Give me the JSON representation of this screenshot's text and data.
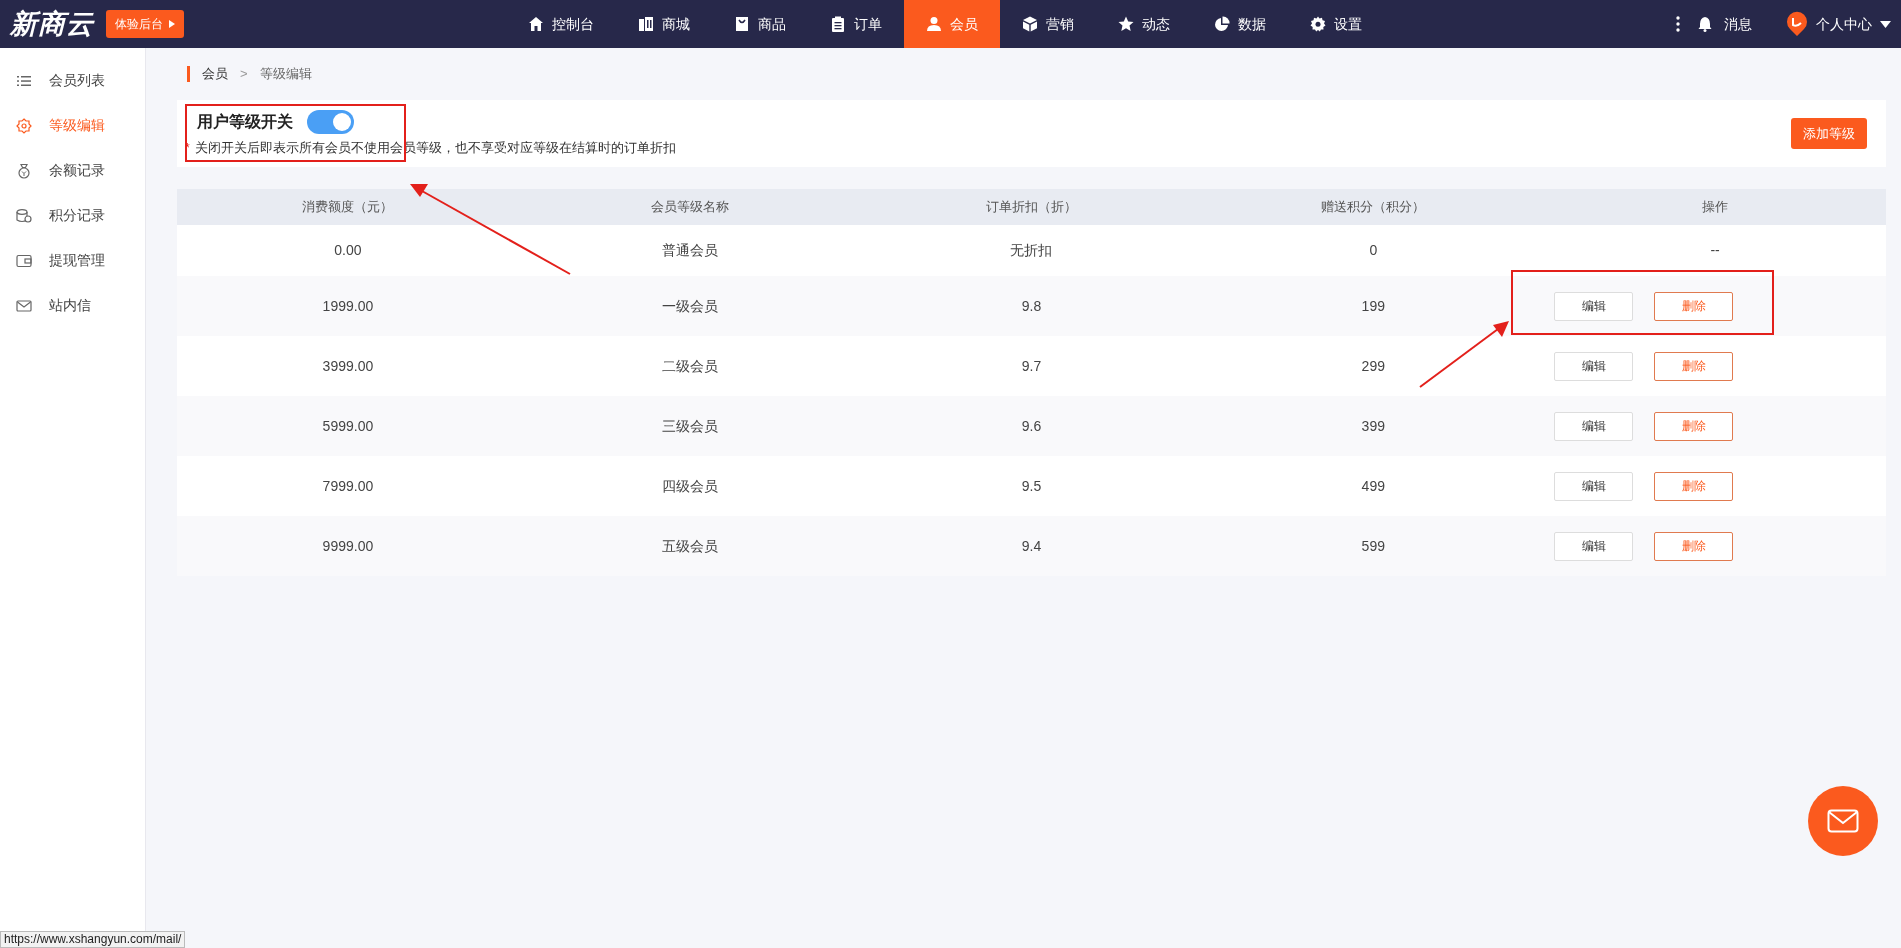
{
  "header": {
    "logo": "新商云",
    "trial_button": "体验后台",
    "nav": [
      {
        "label": "控制台",
        "selected": false
      },
      {
        "label": "商城",
        "selected": false
      },
      {
        "label": "商品",
        "selected": false
      },
      {
        "label": "订单",
        "selected": false
      },
      {
        "label": "会员",
        "selected": true
      },
      {
        "label": "营销",
        "selected": false
      },
      {
        "label": "动态",
        "selected": false
      },
      {
        "label": "数据",
        "selected": false
      },
      {
        "label": "设置",
        "selected": false
      }
    ],
    "messages": "消息",
    "user_menu": "个人中心"
  },
  "sidebar": {
    "items": [
      {
        "label": "会员列表",
        "selected": false
      },
      {
        "label": "等级编辑",
        "selected": true
      },
      {
        "label": "余额记录",
        "selected": false
      },
      {
        "label": "积分记录",
        "selected": false
      },
      {
        "label": "提现管理",
        "selected": false
      },
      {
        "label": "站内信",
        "selected": false
      }
    ]
  },
  "breadcrumb": {
    "items": [
      "会员",
      "等级编辑"
    ],
    "separator": ">"
  },
  "level_switch": {
    "title": "用户等级开关",
    "on": true,
    "required_mark": "*",
    "hint": "关闭开关后即表示所有会员不使用会员等级，也不享受对应等级在结算时的订单折扣"
  },
  "add_button": "添加等级",
  "table": {
    "columns": [
      "消费额度（元）",
      "会员等级名称",
      "订单折扣（折）",
      "赠送积分（积分）",
      "操作"
    ],
    "rows": [
      {
        "cells": [
          "0.00",
          "普通会员",
          "无折扣",
          "0"
        ],
        "actions_text": "--"
      },
      {
        "cells": [
          "1999.00",
          "一级会员",
          "9.8",
          "199"
        ],
        "actions": [
          {
            "label": "编辑",
            "kind": "edit"
          },
          {
            "label": "删除",
            "kind": "delete"
          }
        ]
      },
      {
        "cells": [
          "3999.00",
          "二级会员",
          "9.7",
          "299"
        ],
        "actions": [
          {
            "label": "编辑",
            "kind": "edit"
          },
          {
            "label": "删除",
            "kind": "delete"
          }
        ]
      },
      {
        "cells": [
          "5999.00",
          "三级会员",
          "9.6",
          "399"
        ],
        "actions": [
          {
            "label": "编辑",
            "kind": "edit"
          },
          {
            "label": "删除",
            "kind": "delete"
          }
        ]
      },
      {
        "cells": [
          "7999.00",
          "四级会员",
          "9.5",
          "499"
        ],
        "actions": [
          {
            "label": "编辑",
            "kind": "edit"
          },
          {
            "label": "删除",
            "kind": "delete"
          }
        ]
      },
      {
        "cells": [
          "9999.00",
          "五级会员",
          "9.4",
          "599"
        ],
        "actions": [
          {
            "label": "编辑",
            "kind": "edit"
          },
          {
            "label": "删除",
            "kind": "delete"
          }
        ]
      }
    ]
  },
  "status_url": "https://www.xshangyun.com/mail/"
}
